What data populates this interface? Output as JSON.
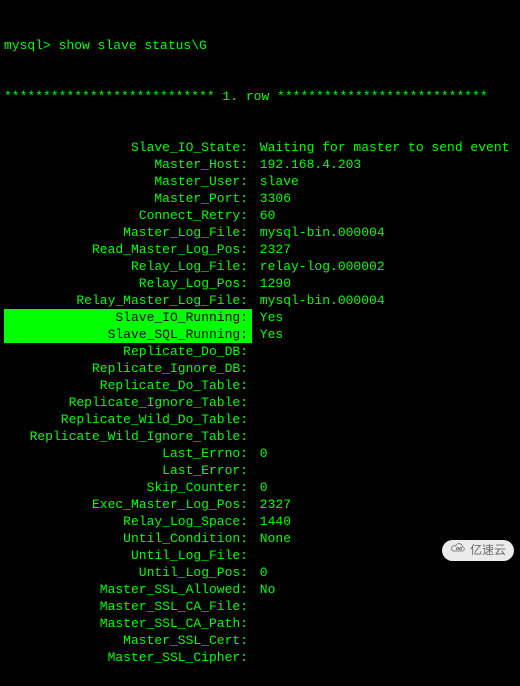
{
  "prompt_line": "mysql> show slave status\\G",
  "row_separator": "*************************** 1. row ***************************",
  "fields": [
    {
      "label": "Slave_IO_State:",
      "value": "Waiting for master to send event",
      "hl": false
    },
    {
      "label": "Master_Host:",
      "value": "192.168.4.203",
      "hl": false
    },
    {
      "label": "Master_User:",
      "value": "slave",
      "hl": false
    },
    {
      "label": "Master_Port:",
      "value": "3306",
      "hl": false
    },
    {
      "label": "Connect_Retry:",
      "value": "60",
      "hl": false
    },
    {
      "label": "Master_Log_File:",
      "value": "mysql-bin.000004",
      "hl": false
    },
    {
      "label": "Read_Master_Log_Pos:",
      "value": "2327",
      "hl": false
    },
    {
      "label": "Relay_Log_File:",
      "value": "relay-log.000002",
      "hl": false
    },
    {
      "label": "Relay_Log_Pos:",
      "value": "1290",
      "hl": false
    },
    {
      "label": "Relay_Master_Log_File:",
      "value": "mysql-bin.000004",
      "hl": false
    },
    {
      "label": "Slave_IO_Running:",
      "value": "Yes",
      "hl": true
    },
    {
      "label": "Slave_SQL_Running:",
      "value": "Yes",
      "hl": true
    },
    {
      "label": "Replicate_Do_DB:",
      "value": "",
      "hl": false
    },
    {
      "label": "Replicate_Ignore_DB:",
      "value": "",
      "hl": false
    },
    {
      "label": "Replicate_Do_Table:",
      "value": "",
      "hl": false
    },
    {
      "label": "Replicate_Ignore_Table:",
      "value": "",
      "hl": false
    },
    {
      "label": "Replicate_Wild_Do_Table:",
      "value": "",
      "hl": false
    },
    {
      "label": "Replicate_Wild_Ignore_Table:",
      "value": "",
      "hl": false
    },
    {
      "label": "Last_Errno:",
      "value": "0",
      "hl": false
    },
    {
      "label": "Last_Error:",
      "value": "",
      "hl": false
    },
    {
      "label": "Skip_Counter:",
      "value": "0",
      "hl": false
    },
    {
      "label": "Exec_Master_Log_Pos:",
      "value": "2327",
      "hl": false
    },
    {
      "label": "Relay_Log_Space:",
      "value": "1440",
      "hl": false
    },
    {
      "label": "Until_Condition:",
      "value": "None",
      "hl": false
    },
    {
      "label": "Until_Log_File:",
      "value": "",
      "hl": false
    },
    {
      "label": "Until_Log_Pos:",
      "value": "0",
      "hl": false
    },
    {
      "label": "Master_SSL_Allowed:",
      "value": "No",
      "hl": false
    },
    {
      "label": "Master_SSL_CA_File:",
      "value": "",
      "hl": false
    },
    {
      "label": "Master_SSL_CA_Path:",
      "value": "",
      "hl": false
    },
    {
      "label": "Master_SSL_Cert:",
      "value": "",
      "hl": false
    },
    {
      "label": "Master_SSL_Cipher:",
      "value": "",
      "hl": false
    }
  ],
  "watermark": "亿速云"
}
